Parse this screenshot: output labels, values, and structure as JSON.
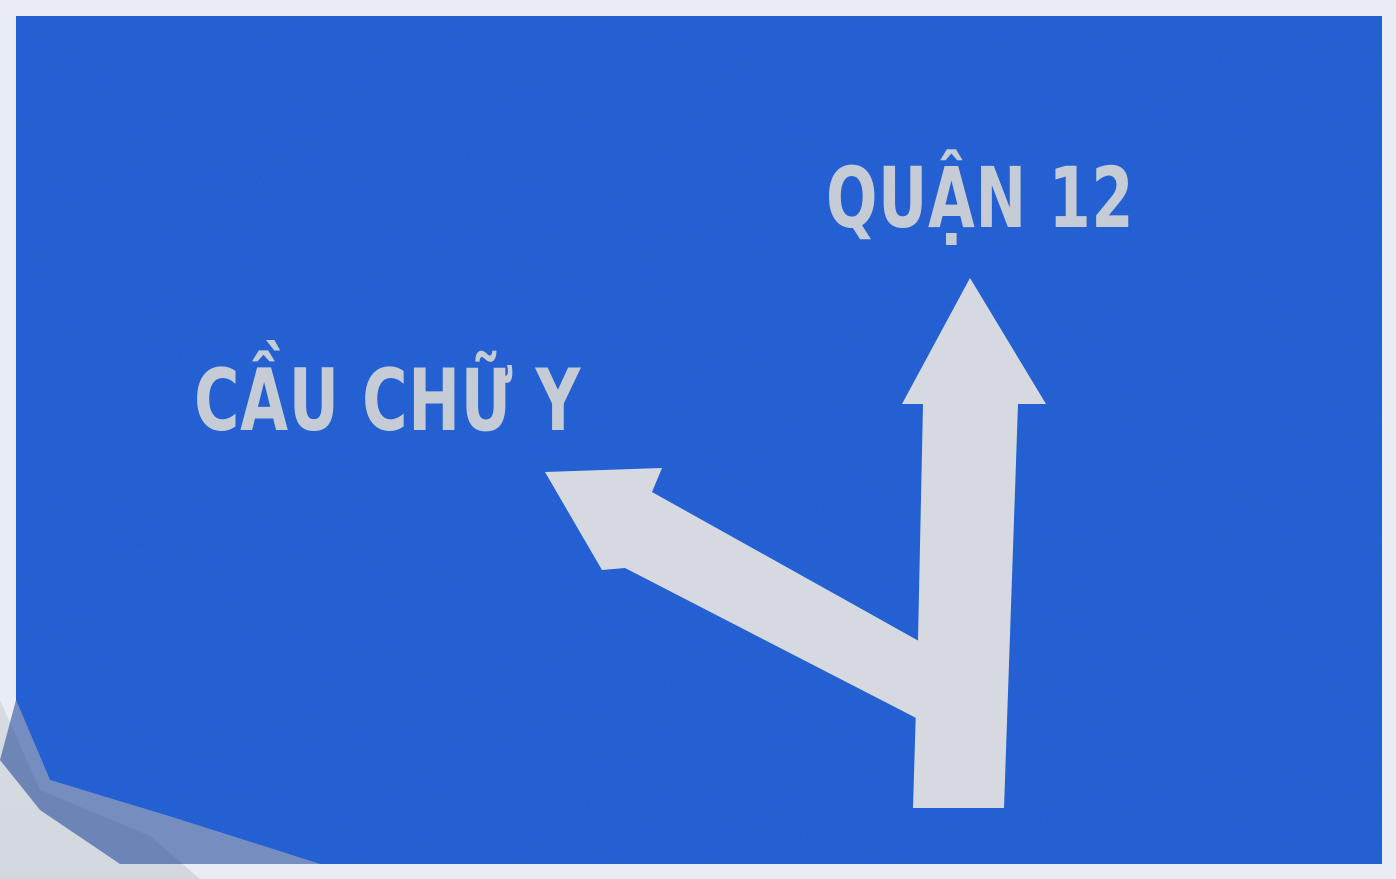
{
  "sign": {
    "background_color": "#1f5bd0",
    "border_color": "#e9edf3",
    "text_color": "#c5ccd6",
    "arrow_color": "#d6dae0"
  },
  "destinations": {
    "left": {
      "label": "CẦU CHỮ Y",
      "direction": "left-diagonal"
    },
    "straight": {
      "label": "QUẬN 12",
      "direction": "straight-ahead"
    }
  }
}
